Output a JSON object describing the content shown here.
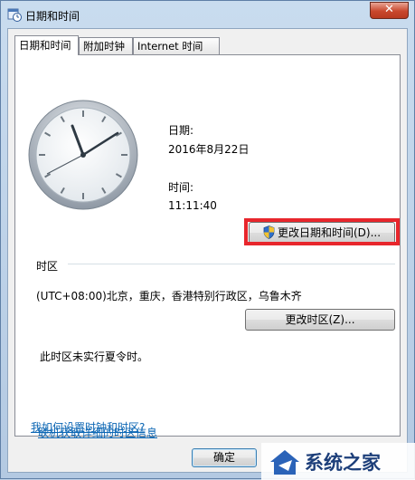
{
  "window": {
    "title": "日期和时间",
    "close_label": "✕"
  },
  "tabs": [
    {
      "label": "日期和时间",
      "active": true
    },
    {
      "label": "附加时钟",
      "active": false
    },
    {
      "label": "Internet 时间",
      "active": false
    }
  ],
  "datetime": {
    "date_label": "日期:",
    "date_value": "2016年8月22日",
    "time_label": "时间:",
    "time_value": "11:11:40",
    "change_button": "更改日期和时间(D)..."
  },
  "timezone": {
    "section_label": "时区",
    "value": "(UTC+08:00)北京，重庆，香港特别行政区，乌鲁木齐",
    "change_button": "更改时区(Z)...",
    "dst_note": "此时区未实行夏令时。"
  },
  "links": [
    "联机获取详细的时区信息",
    "我如何设置时钟和时区?"
  ],
  "footer": {
    "ok_button": "确定"
  },
  "watermark": {
    "text": "系统之家"
  },
  "icons": {
    "title": "calendar-clock-icon",
    "shield": "uac-shield-icon",
    "clock": "analog-clock-icon"
  },
  "colors": {
    "highlight": "#e8262c",
    "link": "#0d67b4",
    "close": "#c9482d"
  }
}
